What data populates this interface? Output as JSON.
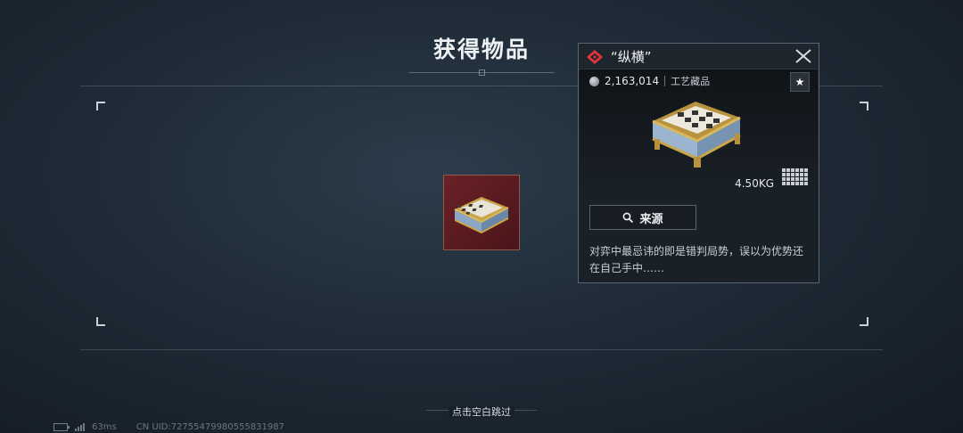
{
  "title": "获得物品",
  "item": {
    "name": "“纵横”",
    "value": "2,163,014",
    "category": "工艺藏品",
    "weight": "4.50KG",
    "source_label": "来源",
    "description": "对弈中最忌讳的即是错判局势，误以为优势还在自己手中……",
    "rarity_color": "#e0353a"
  },
  "skip_hint": "点击空白跳过",
  "status": {
    "ping": "63ms",
    "uid": "CN UID:72755479980555831987"
  },
  "colors": {
    "slot_bg": "#5a1c20",
    "panel_bg": "#1a2028"
  }
}
